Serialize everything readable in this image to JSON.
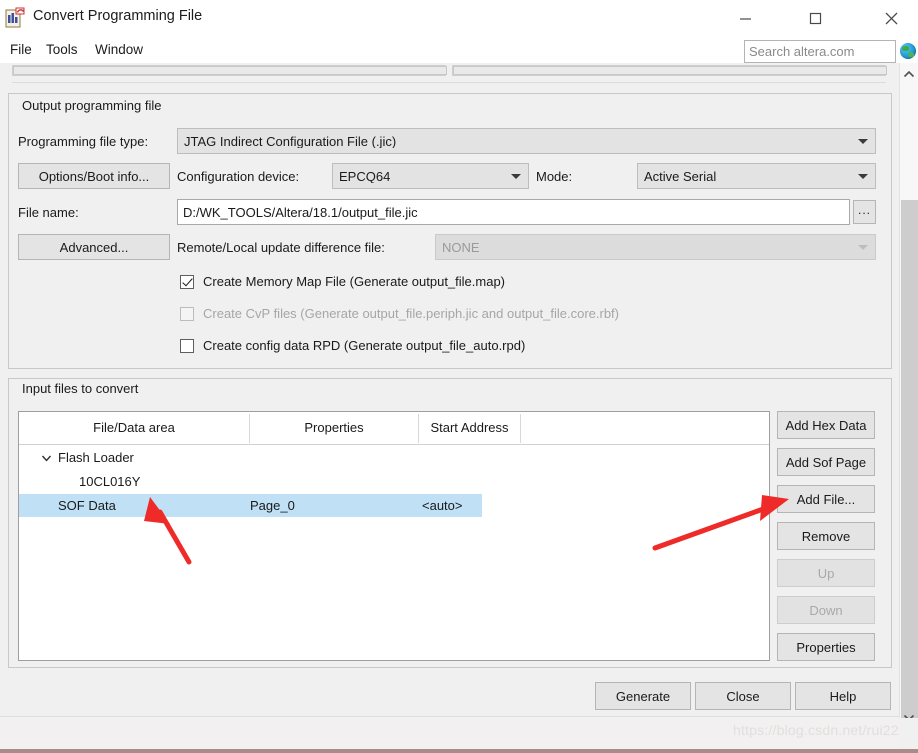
{
  "window": {
    "title": "Convert Programming File",
    "icon": "app-convert-icon",
    "controls": {
      "minimize": "minimize-icon",
      "maximize": "maximize-icon",
      "close": "close-icon"
    }
  },
  "menubar": {
    "items": [
      {
        "label": "File"
      },
      {
        "label": "Tools"
      },
      {
        "label": "Window"
      }
    ],
    "search": {
      "placeholder": "Search altera.com",
      "value": "",
      "icon": "globe-icon"
    }
  },
  "output_group": {
    "title": "Output programming file",
    "programming_file_type": {
      "label": "Programming file type:",
      "value": "JTAG Indirect Configuration File (.jic)"
    },
    "options_boot_button": "Options/Boot info...",
    "configuration_device": {
      "label": "Configuration device:",
      "value": "EPCQ64"
    },
    "mode": {
      "label": "Mode:",
      "value": "Active Serial"
    },
    "file_name": {
      "label": "File name:",
      "value": "D:/WK_TOOLS/Altera/18.1/output_file.jic"
    },
    "browse_button": "...",
    "advanced_button": "Advanced...",
    "remote_local": {
      "label": "Remote/Local update difference file:",
      "value": "NONE",
      "disabled": true
    },
    "checkboxes": [
      {
        "label": "Create Memory Map File (Generate output_file.map)",
        "checked": true,
        "disabled": false
      },
      {
        "label": "Create CvP files (Generate output_file.periph.jic and output_file.core.rbf)",
        "checked": false,
        "disabled": true
      },
      {
        "label": "Create config data RPD (Generate output_file_auto.rpd)",
        "checked": false,
        "disabled": false
      }
    ]
  },
  "input_group": {
    "title": "Input files to convert",
    "columns": [
      "File/Data area",
      "Properties",
      "Start Address"
    ],
    "rows": [
      {
        "file_data_area": "Flash Loader",
        "properties": "",
        "start_address": "",
        "expandable": true,
        "selected": false
      },
      {
        "file_data_area": "10CL016Y",
        "properties": "",
        "start_address": "",
        "expandable": false,
        "selected": false
      },
      {
        "file_data_area": "SOF Data",
        "properties": "Page_0",
        "start_address": "<auto>",
        "expandable": false,
        "selected": true
      }
    ],
    "side_buttons": [
      {
        "label": "Add Hex Data",
        "disabled": false
      },
      {
        "label": "Add Sof Page",
        "disabled": false
      },
      {
        "label": "Add File...",
        "disabled": false
      },
      {
        "label": "Remove",
        "disabled": false
      },
      {
        "label": "Up",
        "disabled": true
      },
      {
        "label": "Down",
        "disabled": true
      },
      {
        "label": "Properties",
        "disabled": false
      }
    ]
  },
  "footer": {
    "buttons": [
      {
        "label": "Generate"
      },
      {
        "label": "Close"
      },
      {
        "label": "Help"
      }
    ],
    "watermark": "https://blog.csdn.net/rui22"
  },
  "annotations": {
    "arrow_color": "#ee2b28",
    "arrows": [
      {
        "name": "arrow-to-sof-data",
        "points_to": "SOF Data"
      },
      {
        "name": "arrow-to-add-file",
        "points_to": "Add File..."
      }
    ]
  },
  "colors": {
    "selection_blue": "#bfe0f5",
    "window_bg": "#f0f0f0",
    "accent_red": "#ee2b28"
  }
}
